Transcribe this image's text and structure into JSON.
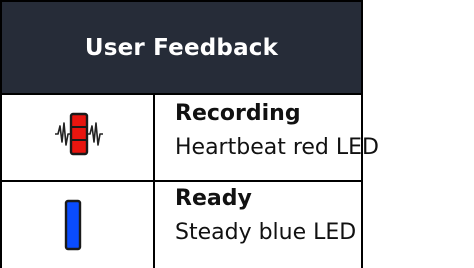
{
  "table": {
    "header": "User Feedback",
    "rows": [
      {
        "icon": "heartbeat-red-led-icon",
        "label": "Recording",
        "description": "Heartbeat red LED",
        "color": "#e8150f"
      },
      {
        "icon": "steady-blue-led-icon",
        "label": "Ready",
        "description": "Steady blue LED",
        "color": "#0a4cff"
      }
    ]
  }
}
